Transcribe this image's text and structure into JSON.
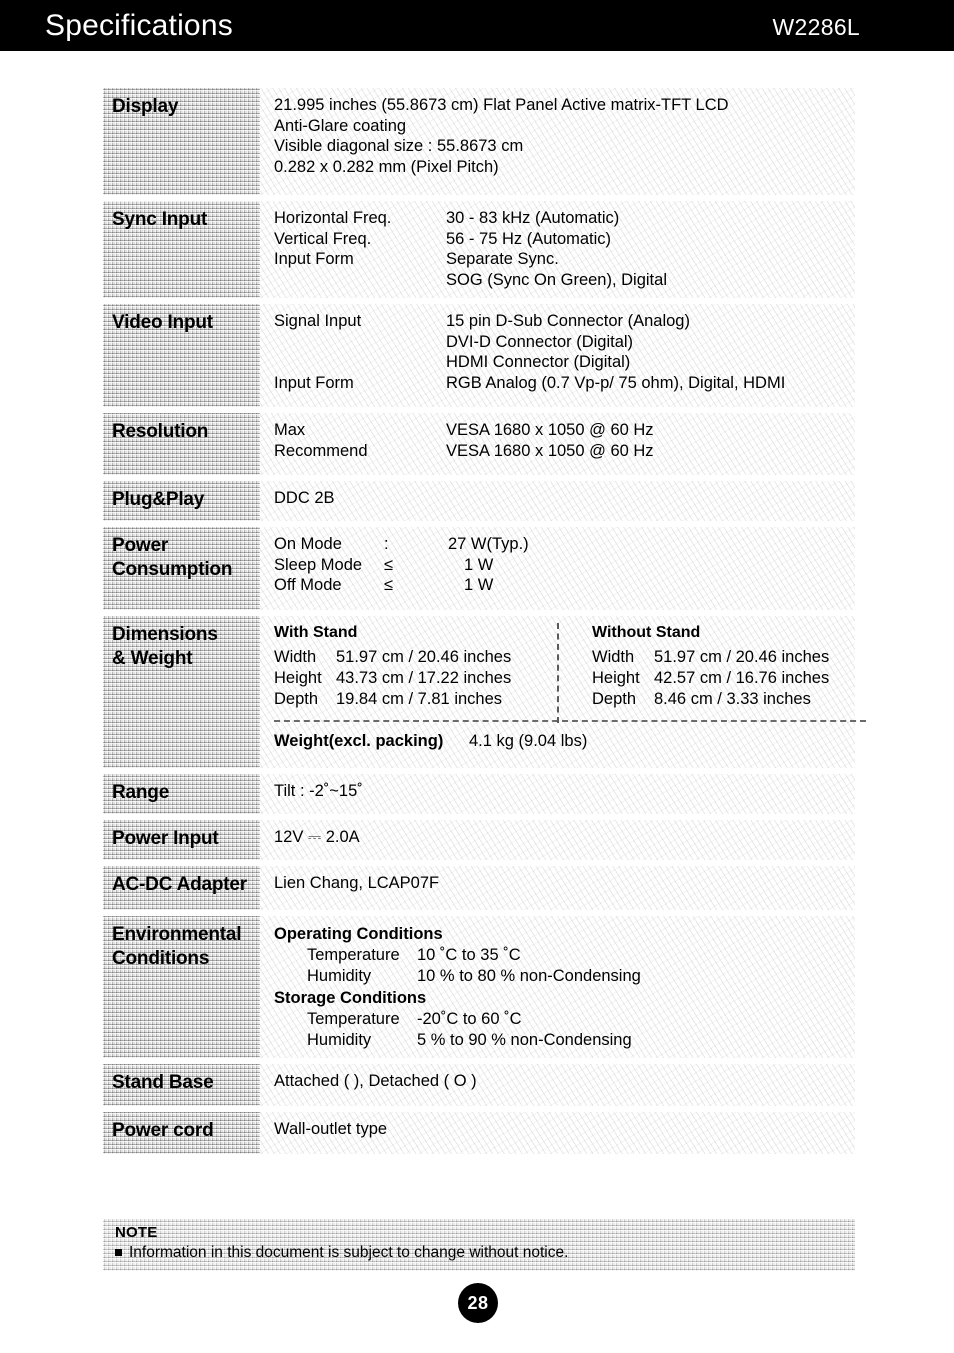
{
  "header": {
    "title": "Specifications",
    "model": "W2286L"
  },
  "spec_rows": [
    {
      "label": "Display",
      "lines": [
        "21.995 inches (55.8673 cm) Flat Panel Active matrix-TFT LCD",
        "Anti-Glare coating",
        "Visible diagonal size : 55.8673 cm",
        "0.282 x 0.282 mm (Pixel Pitch)"
      ]
    },
    {
      "label": "Sync Input",
      "pairs": [
        {
          "key": "Horizontal Freq.",
          "value": "30 - 83 kHz (Automatic)"
        },
        {
          "key": "Vertical Freq.",
          "value": "56 - 75 Hz (Automatic)"
        },
        {
          "key": "Input Form",
          "value": "Separate Sync."
        },
        {
          "key": "",
          "value": "SOG (Sync On Green), Digital"
        }
      ]
    },
    {
      "label": "Video Input",
      "pairs": [
        {
          "key": "Signal Input",
          "value": "15 pin D-Sub Connector (Analog)"
        },
        {
          "key": "",
          "value": "DVI-D Connector (Digital)"
        },
        {
          "key": "",
          "value": "HDMI Connector (Digital)"
        },
        {
          "key": "Input Form",
          "value": "RGB Analog (0.7 Vp-p/ 75 ohm), Digital, HDMI"
        }
      ]
    },
    {
      "label": "Resolution",
      "pairs": [
        {
          "key": "Max",
          "value": "VESA 1680 x 1050 @ 60 Hz"
        },
        {
          "key": "Recommend",
          "value": "VESA 1680 x 1050 @ 60 Hz"
        }
      ]
    },
    {
      "label": "Plug&Play",
      "lines": [
        "DDC 2B"
      ]
    }
  ],
  "power_consumption": {
    "label": "Power Consumption",
    "label_line1": "Power",
    "label_line2": "Consumption",
    "rows": [
      {
        "mode": "On Mode",
        "op": ":",
        "value": "27 W(Typ.)"
      },
      {
        "mode": "Sleep Mode",
        "op": "≤",
        "value": "1 W"
      },
      {
        "mode": "Off Mode",
        "op": "≤",
        "value": "1 W"
      }
    ]
  },
  "dimensions": {
    "label_line1": "Dimensions",
    "label_line2": "& Weight",
    "with_stand": {
      "heading": "With Stand",
      "rows": [
        {
          "key": "Width",
          "value": "51.97 cm / 20.46 inches"
        },
        {
          "key": "Height",
          "value": "43.73 cm / 17.22 inches"
        },
        {
          "key": "Depth",
          "value": "19.84 cm /  7.81 inches"
        }
      ]
    },
    "without_stand": {
      "heading": "Without Stand",
      "rows": [
        {
          "key": "Width",
          "value": "51.97 cm / 20.46 inches"
        },
        {
          "key": "Height",
          "value": "42.57 cm / 16.76 inches"
        },
        {
          "key": "Depth",
          "value": "8.46 cm /  3.33 inches"
        }
      ]
    },
    "weight_label": "Weight(excl. packing)",
    "weight_value": "4.1 kg (9.04 lbs)"
  },
  "range": {
    "label": "Range",
    "value": "Tilt : -2˚~15˚"
  },
  "power_input": {
    "label": "Power Input",
    "value": "12V ⎓ 2.0A"
  },
  "adapter": {
    "label": "AC-DC Adapter",
    "value": "Lien Chang, LCAP07F"
  },
  "environmental": {
    "label_line1": "Environmental",
    "label_line2": "Conditions",
    "operating": {
      "heading": "Operating Conditions",
      "rows": [
        {
          "key": "Temperature",
          "value": "10 ˚C to 35 ˚C"
        },
        {
          "key": "Humidity",
          "value": "10 % to 80 % non-Condensing"
        }
      ]
    },
    "storage": {
      "heading": "Storage Conditions",
      "rows": [
        {
          "key": "Temperature",
          "value": "-20˚C to 60 ˚C"
        },
        {
          "key": "Humidity",
          "value": "5 % to 90 % non-Condensing"
        }
      ]
    }
  },
  "stand_base": {
    "label": "Stand Base",
    "value": "Attached (    ), Detached ( O )"
  },
  "power_cord": {
    "label": "Power cord",
    "value": "Wall-outlet type"
  },
  "note": {
    "title": "NOTE",
    "item": "Information in this document is subject to change without notice."
  },
  "page_number": "28"
}
